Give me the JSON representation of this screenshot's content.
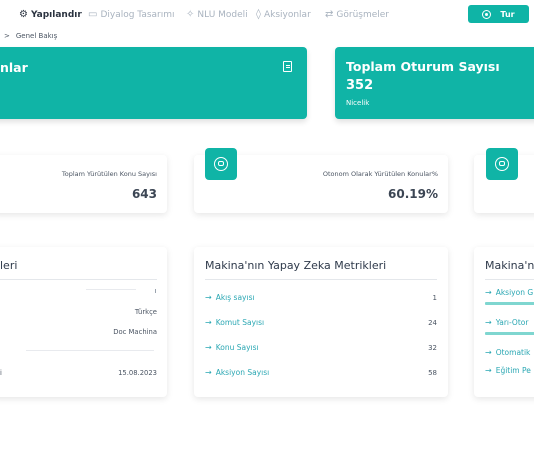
{
  "nav": {
    "items": [
      {
        "label": "Yapılandır",
        "icon": "gear-icon"
      },
      {
        "label": "Diyalog Tasarımı",
        "icon": "chat-icon"
      },
      {
        "label": "NLU Modeli",
        "icon": "brain-icon"
      },
      {
        "label": "Aksiyonlar",
        "icon": "bolt-icon"
      },
      {
        "label": "Görüşmeler",
        "icon": "swap-icon"
      }
    ],
    "tour_button": "Tur"
  },
  "breadcrumb": {
    "separator": ">",
    "label": "Genel Bakış"
  },
  "top_cards": {
    "left_title": "nlar",
    "right_title": "Toplam Oturum Sayısı",
    "right_value": "352",
    "right_caption": "Nicelik"
  },
  "stats": [
    {
      "label": "Toplam Yürütülen Konu Sayısı",
      "value": "643"
    },
    {
      "label": "Otonom Olarak Yürütülen Konular%",
      "value": "60.19%"
    }
  ],
  "info_card": {
    "title": "leri",
    "values": [
      "Türkçe",
      "Doc Machina",
      "15.08.2023"
    ],
    "partial_label": "i"
  },
  "ai_metrics": {
    "title": "Makina'nın Yapay Zeka Metrikleri",
    "rows": [
      {
        "label": "Akış sayısı",
        "value": "1"
      },
      {
        "label": "Komut Sayısı",
        "value": "24"
      },
      {
        "label": "Konu Sayısı",
        "value": "32"
      },
      {
        "label": "Aksiyon Sayısı",
        "value": "58"
      }
    ]
  },
  "right_metrics": {
    "title": "Makina'nı",
    "rows": [
      {
        "label": "Aksiyon G",
        "bar": 0.9
      },
      {
        "label": "Yarı-Otor",
        "bar": 0.9
      },
      {
        "label": "Otomatik",
        "bar": 0
      },
      {
        "label": "Eğitim Pe",
        "bar": 0
      }
    ]
  }
}
